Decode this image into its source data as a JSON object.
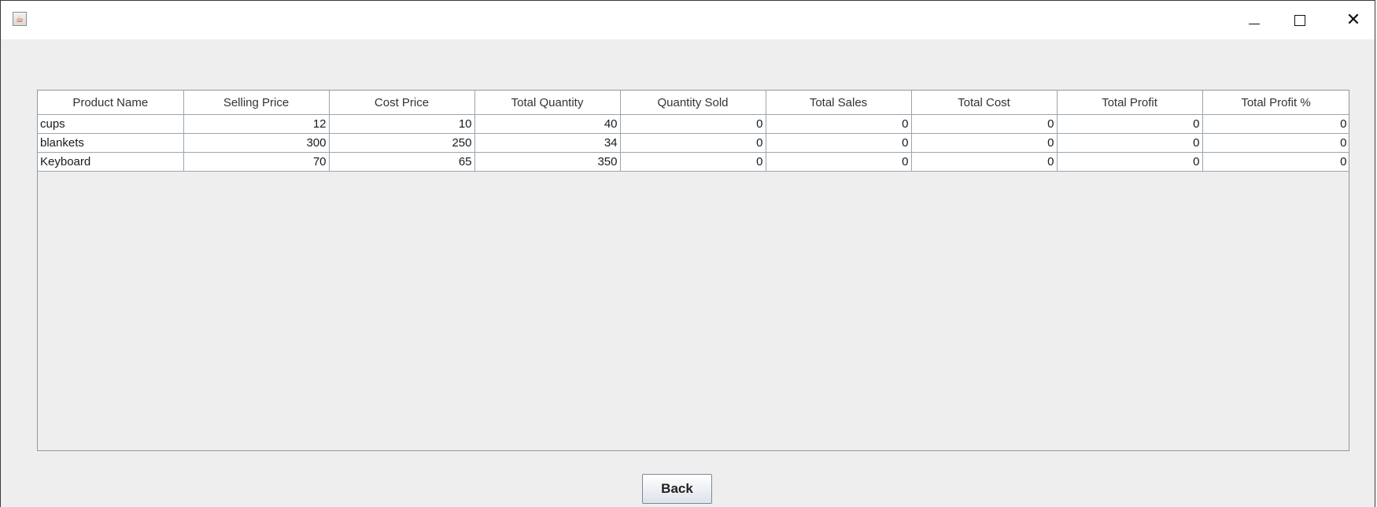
{
  "window": {
    "title": "",
    "controls": {
      "minimize_icon": "minimize-icon",
      "maximize_icon": "maximize-icon",
      "close_icon": "close-icon",
      "close_glyph": "✕"
    }
  },
  "table": {
    "columns": [
      "Product Name",
      "Selling Price",
      "Cost Price",
      "Total Quantity",
      "Quantity Sold",
      "Total Sales",
      "Total Cost",
      "Total Profit",
      "Total Profit %"
    ],
    "rows": [
      [
        "cups",
        "12",
        "10",
        "40",
        "0",
        "0",
        "0",
        "0",
        "0"
      ],
      [
        "blankets",
        "300",
        "250",
        "34",
        "0",
        "0",
        "0",
        "0",
        "0"
      ],
      [
        "Keyboard",
        "70",
        "65",
        "350",
        "0",
        "0",
        "0",
        "0",
        "0"
      ]
    ]
  },
  "buttons": {
    "back_label": "Back"
  }
}
